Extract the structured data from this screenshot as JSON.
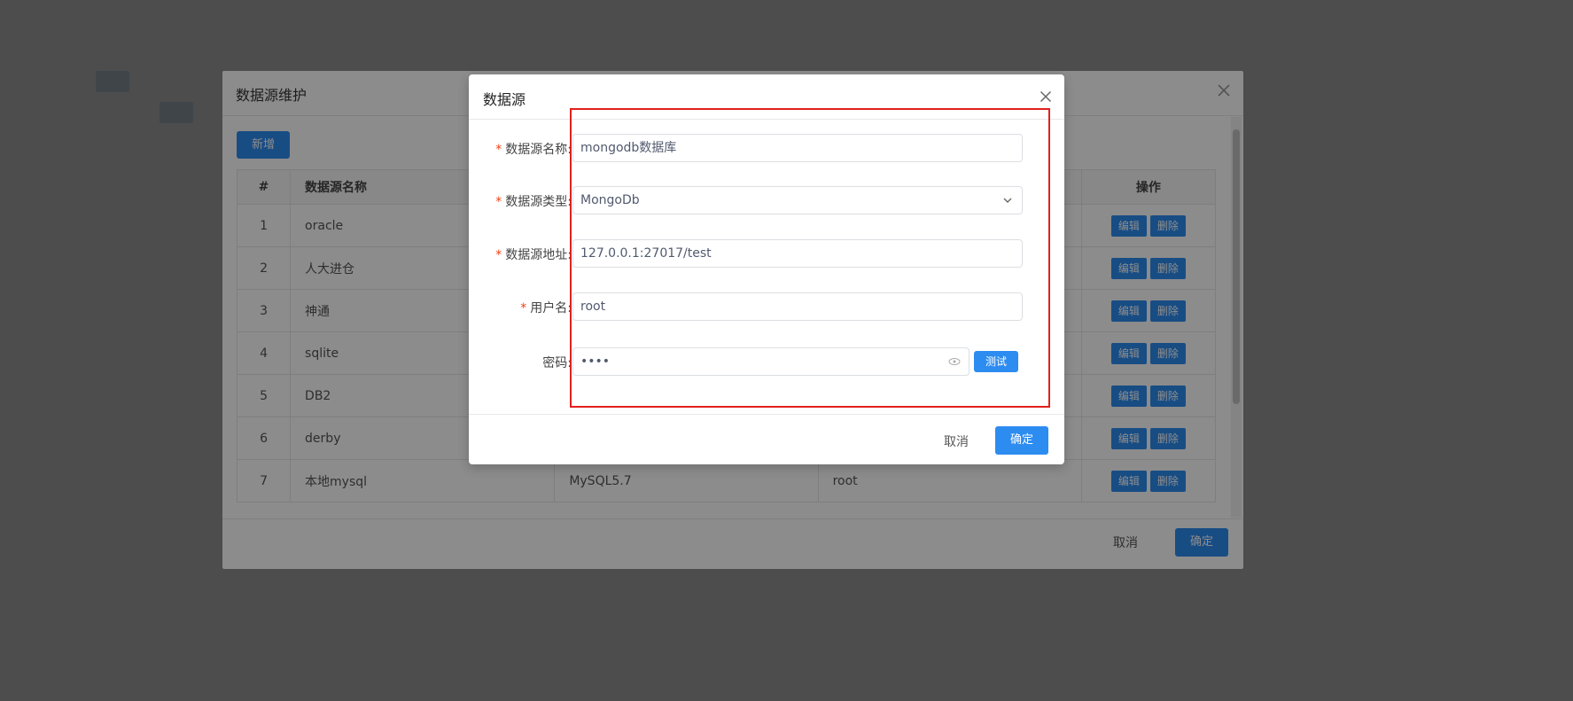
{
  "outer_dialog": {
    "title": "数据源维护",
    "add_label": "新增",
    "columns": [
      "#",
      "数据源名称",
      "",
      "",
      "操作"
    ],
    "rows": [
      {
        "idx": "1",
        "name": "oracle",
        "type": "",
        "user": ""
      },
      {
        "idx": "2",
        "name": "人大进仓",
        "type": "",
        "user": ""
      },
      {
        "idx": "3",
        "name": "神通",
        "type": "",
        "user": ""
      },
      {
        "idx": "4",
        "name": "sqlite",
        "type": "",
        "user": ""
      },
      {
        "idx": "5",
        "name": "DB2",
        "type": "",
        "user": ""
      },
      {
        "idx": "6",
        "name": "derby",
        "type": "",
        "user": ""
      },
      {
        "idx": "7",
        "name": "本地mysql",
        "type": "MySQL5.7",
        "user": "root"
      }
    ],
    "edit_label": "编辑",
    "delete_label": "删除",
    "cancel_label": "取消",
    "ok_label": "确定"
  },
  "dialog": {
    "title": "数据源",
    "fields": {
      "name": {
        "label": "数据源名称:",
        "value": "mongodb数据库",
        "required": true
      },
      "type": {
        "label": "数据源类型:",
        "value": "MongoDb",
        "required": true
      },
      "address": {
        "label": "数据源地址:",
        "value": "127.0.0.1:27017/test",
        "required": true
      },
      "username": {
        "label": "用户名:",
        "value": "root",
        "required": true
      },
      "password": {
        "label": "密码:",
        "value": "••••",
        "required": false
      }
    },
    "test_label": "测试",
    "cancel_label": "取消",
    "ok_label": "确定"
  },
  "colors": {
    "primary": "#2d8cf0",
    "required": "#ed4014",
    "highlight": "#e0211d"
  }
}
